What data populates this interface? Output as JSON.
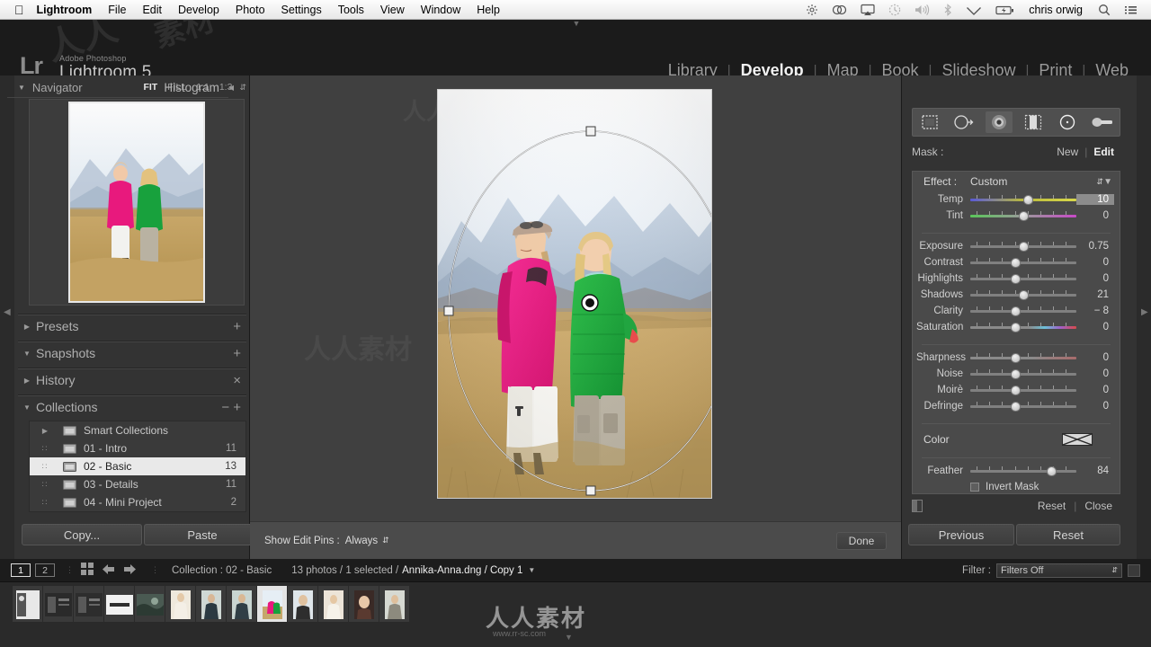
{
  "macbar": {
    "apple_icon": "apple-icon",
    "menus": [
      {
        "label": "Lightroom",
        "bold": true
      },
      {
        "label": "File",
        "bold": false
      },
      {
        "label": "Edit",
        "bold": false
      },
      {
        "label": "Develop",
        "bold": false
      },
      {
        "label": "Photo",
        "bold": false
      },
      {
        "label": "Settings",
        "bold": false
      },
      {
        "label": "Tools",
        "bold": false
      },
      {
        "label": "View",
        "bold": false
      },
      {
        "label": "Window",
        "bold": false
      },
      {
        "label": "Help",
        "bold": false
      }
    ],
    "status_icons": [
      {
        "name": "brightness-icon",
        "glyph": "✳",
        "dim": false
      },
      {
        "name": "creative-cloud-icon",
        "glyph": "♾",
        "dim": false
      },
      {
        "name": "airplay-icon",
        "glyph": "▲",
        "dim": false
      },
      {
        "name": "time-machine-icon",
        "glyph": "◷",
        "dim": true
      },
      {
        "name": "volume-icon",
        "glyph": "◀",
        "dim": true
      },
      {
        "name": "bluetooth-icon",
        "glyph": "ᛦ",
        "dim": true
      },
      {
        "name": "wifi-icon",
        "glyph": "▽",
        "dim": false
      },
      {
        "name": "battery-icon",
        "glyph": "⚡",
        "dim": false
      }
    ],
    "username": "chris orwig",
    "search_icon": "search-icon",
    "notification_icon": "notification-center-icon"
  },
  "header": {
    "logo_mark": "Lr",
    "brand_small": "Adobe Photoshop",
    "brand_large": "Lightroom 5",
    "modules": [
      {
        "label": "Library",
        "active": false
      },
      {
        "label": "Develop",
        "active": true
      },
      {
        "label": "Map",
        "active": false
      },
      {
        "label": "Book",
        "active": false
      },
      {
        "label": "Slideshow",
        "active": false
      },
      {
        "label": "Print",
        "active": false
      },
      {
        "label": "Web",
        "active": false
      }
    ]
  },
  "left_panel": {
    "navigator": {
      "title": "Navigator",
      "zoom_levels": [
        {
          "label": "FIT",
          "active": true
        },
        {
          "label": "FILL",
          "active": false
        },
        {
          "label": "1:1",
          "active": false
        },
        {
          "label": "1:3",
          "active": false
        }
      ]
    },
    "sections": [
      {
        "title": "Presets",
        "expanded": false,
        "action": "+"
      },
      {
        "title": "Snapshots",
        "expanded": true,
        "action": "+"
      },
      {
        "title": "History",
        "expanded": false,
        "action": "×"
      },
      {
        "title": "Collections",
        "expanded": true,
        "action": "−  +"
      }
    ],
    "collections": [
      {
        "label": "Smart Collections",
        "count": "",
        "selected": false,
        "has_triangle": true
      },
      {
        "label": "01 - Intro",
        "count": "11",
        "selected": false,
        "has_triangle": false
      },
      {
        "label": "02 - Basic",
        "count": "13",
        "selected": true,
        "has_triangle": false
      },
      {
        "label": "03 - Details",
        "count": "11",
        "selected": false,
        "has_triangle": false
      },
      {
        "label": "04 - Mini Project",
        "count": "2",
        "selected": false,
        "has_triangle": false
      }
    ],
    "copy_button": "Copy...",
    "paste_button": "Paste"
  },
  "center": {
    "toolbar": {
      "show_edit_pins_label": "Show Edit Pins :",
      "show_edit_pins_value": "Always",
      "done_button": "Done"
    }
  },
  "right_panel": {
    "histogram_title": "Histogram",
    "tools": [
      {
        "name": "crop-tool-icon",
        "active": false
      },
      {
        "name": "spot-removal-tool-icon",
        "active": false
      },
      {
        "name": "red-eye-tool-icon",
        "active": false
      },
      {
        "name": "graduated-filter-tool-icon",
        "active": false
      },
      {
        "name": "radial-filter-tool-icon",
        "active": true
      },
      {
        "name": "adjustment-brush-tool-icon",
        "active": false
      }
    ],
    "mask": {
      "label": "Mask :",
      "new_link": "New",
      "edit_link": "Edit",
      "active": "Edit"
    },
    "effect": {
      "label": "Effect :",
      "value": "Custom"
    },
    "sliders": [
      {
        "name": "Temp",
        "value": "10",
        "pos": 54,
        "type": "temp",
        "highlight": true
      },
      {
        "name": "Tint",
        "value": "0",
        "pos": 50,
        "type": "tint",
        "highlight": false
      },
      {
        "name": "Exposure",
        "value": "0.75",
        "pos": 50,
        "type": "plain",
        "highlight": false
      },
      {
        "name": "Contrast",
        "value": "0",
        "pos": 42,
        "type": "plain",
        "highlight": false
      },
      {
        "name": "Highlights",
        "value": "0",
        "pos": 42,
        "type": "plain",
        "highlight": false
      },
      {
        "name": "Shadows",
        "value": "21",
        "pos": 50,
        "type": "plain",
        "highlight": false
      },
      {
        "name": "Clarity",
        "value": "− 8",
        "pos": 42,
        "type": "plain",
        "highlight": false
      },
      {
        "name": "Saturation",
        "value": "0",
        "pos": 42,
        "type": "saturation",
        "highlight": false
      }
    ],
    "sliders2": [
      {
        "name": "Sharpness",
        "value": "0",
        "pos": 42,
        "type": "sharp",
        "highlight": false
      },
      {
        "name": "Noise",
        "value": "0",
        "pos": 42,
        "type": "plain",
        "highlight": false
      },
      {
        "name": "Moirè",
        "value": "0",
        "pos": 42,
        "type": "plain",
        "highlight": false
      },
      {
        "name": "Defringe",
        "value": "0",
        "pos": 42,
        "type": "plain",
        "highlight": false
      }
    ],
    "color": {
      "label": "Color",
      "swatch_name": "color-swatch-empty"
    },
    "feather": {
      "name": "Feather",
      "value": "84",
      "pos": 76
    },
    "invert_mask": {
      "label": "Invert Mask",
      "checked": false
    },
    "footer": {
      "reset": "Reset",
      "close": "Close",
      "switch_name": "panel-switch"
    },
    "previous_button": "Previous",
    "reset_button": "Reset"
  },
  "status_bar": {
    "page_1": "1",
    "page_2": "2",
    "grid_icon": "grid-view-icon",
    "back_icon": "back-arrow-icon",
    "forward_icon": "forward-arrow-icon",
    "collection_label": "Collection : 02 - Basic",
    "photo_count": "13 photos / 1 selected /",
    "filename": "Annika-Anna.dng / Copy 1",
    "filter_label": "Filter :",
    "filter_value": "Filters Off"
  },
  "filmstrip": {
    "selected_index": 8,
    "thumb_count": 13
  },
  "watermark": {
    "main": "人人素材",
    "sub": "www.rr-sc.com"
  },
  "colors": {
    "panel_bg": "#333333",
    "center_bg": "#404040",
    "effect_bg": "#4a4a4a",
    "selection": "#e9e9e9",
    "accent_text": "#f2f2f2"
  }
}
